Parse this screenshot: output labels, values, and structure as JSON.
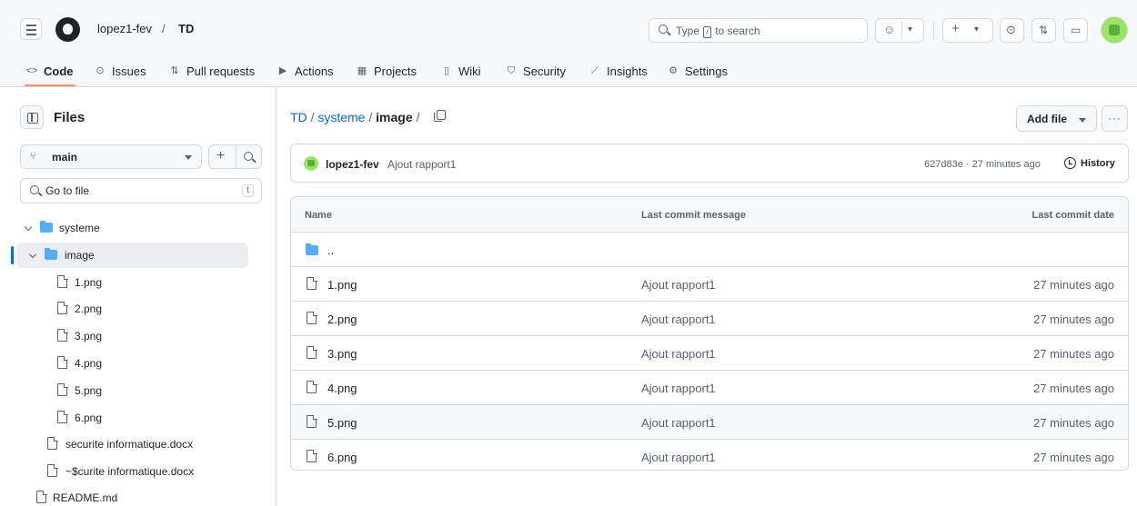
{
  "header": {
    "owner": "lopez1-fev",
    "separator": "/",
    "repo": "TD",
    "search_prefix": "Type",
    "search_key": "/",
    "search_suffix": "to search",
    "copilot_glyph": "☺",
    "plus_glyph": "+",
    "caret_glyph": "▾",
    "issues_glyph": "⊙",
    "pr_glyph": "⇅",
    "inbox_glyph": "▭",
    "icons": [
      "menu-icon",
      "github-logo",
      "search-icon",
      "copilot-icon",
      "plus-icon",
      "issues-icon",
      "pull-requests-icon",
      "inbox-icon",
      "avatar"
    ]
  },
  "nav": {
    "tabs": [
      {
        "label": "Code",
        "icon": "code-icon",
        "glyph": "<>"
      },
      {
        "label": "Issues",
        "icon": "issue-icon",
        "glyph": "⊙"
      },
      {
        "label": "Pull requests",
        "icon": "pull-request-icon",
        "glyph": "⇅"
      },
      {
        "label": "Actions",
        "icon": "play-icon",
        "glyph": "▶"
      },
      {
        "label": "Projects",
        "icon": "table-icon",
        "glyph": "▦"
      },
      {
        "label": "Wiki",
        "icon": "book-icon",
        "glyph": "▯"
      },
      {
        "label": "Security",
        "icon": "shield-icon",
        "glyph": "⛉"
      },
      {
        "label": "Insights",
        "icon": "graph-icon",
        "glyph": "⟋"
      },
      {
        "label": "Settings",
        "icon": "gear-icon",
        "glyph": "⚙"
      }
    ],
    "active": "Code"
  },
  "sidebar": {
    "title": "Files",
    "branch": "main",
    "branch_glyph": "⑂",
    "plus_glyph": "+",
    "go_to_file_placeholder": "Go to file",
    "go_to_file_key": "t",
    "tree": [
      {
        "label": "systeme",
        "type": "folder",
        "expanded": true
      },
      {
        "label": "image",
        "type": "folder",
        "expanded": true,
        "selected": true
      },
      {
        "label": "1.png",
        "type": "file"
      },
      {
        "label": "2.png",
        "type": "file"
      },
      {
        "label": "3.png",
        "type": "file"
      },
      {
        "label": "4.png",
        "type": "file"
      },
      {
        "label": "5.png",
        "type": "file"
      },
      {
        "label": "6.png",
        "type": "file"
      },
      {
        "label": "securite informatique.docx",
        "type": "file"
      },
      {
        "label": "~$curite informatique.docx",
        "type": "file"
      },
      {
        "label": "README.md",
        "type": "file"
      }
    ]
  },
  "main": {
    "breadcrumb": {
      "root": "TD",
      "sep": "/",
      "folder": "systeme",
      "current": "image",
      "trailing": "/"
    },
    "add_file_label": "Add file",
    "more_label": "···",
    "commit": {
      "author": "lopez1-fev",
      "message": "Ajout rapport1",
      "meta": "627d83e · 27 minutes ago",
      "history_label": "History"
    },
    "table": {
      "headers": [
        "Name",
        "Last commit message",
        "Last commit date"
      ],
      "parent_label": "..",
      "rows": [
        {
          "name": "1.png",
          "message": "Ajout rapport1",
          "date": "27 minutes ago"
        },
        {
          "name": "2.png",
          "message": "Ajout rapport1",
          "date": "27 minutes ago"
        },
        {
          "name": "3.png",
          "message": "Ajout rapport1",
          "date": "27 minutes ago"
        },
        {
          "name": "4.png",
          "message": "Ajout rapport1",
          "date": "27 minutes ago"
        },
        {
          "name": "5.png",
          "message": "Ajout rapport1",
          "date": "27 minutes ago"
        },
        {
          "name": "6.png",
          "message": "Ajout rapport1",
          "date": "27 minutes ago"
        }
      ],
      "hovered_row": "5.png"
    }
  },
  "colors": {
    "accent": "#0969da",
    "folder": "#54aeff",
    "nav_underline": "#fd8c73",
    "avatar": "#9be564"
  }
}
